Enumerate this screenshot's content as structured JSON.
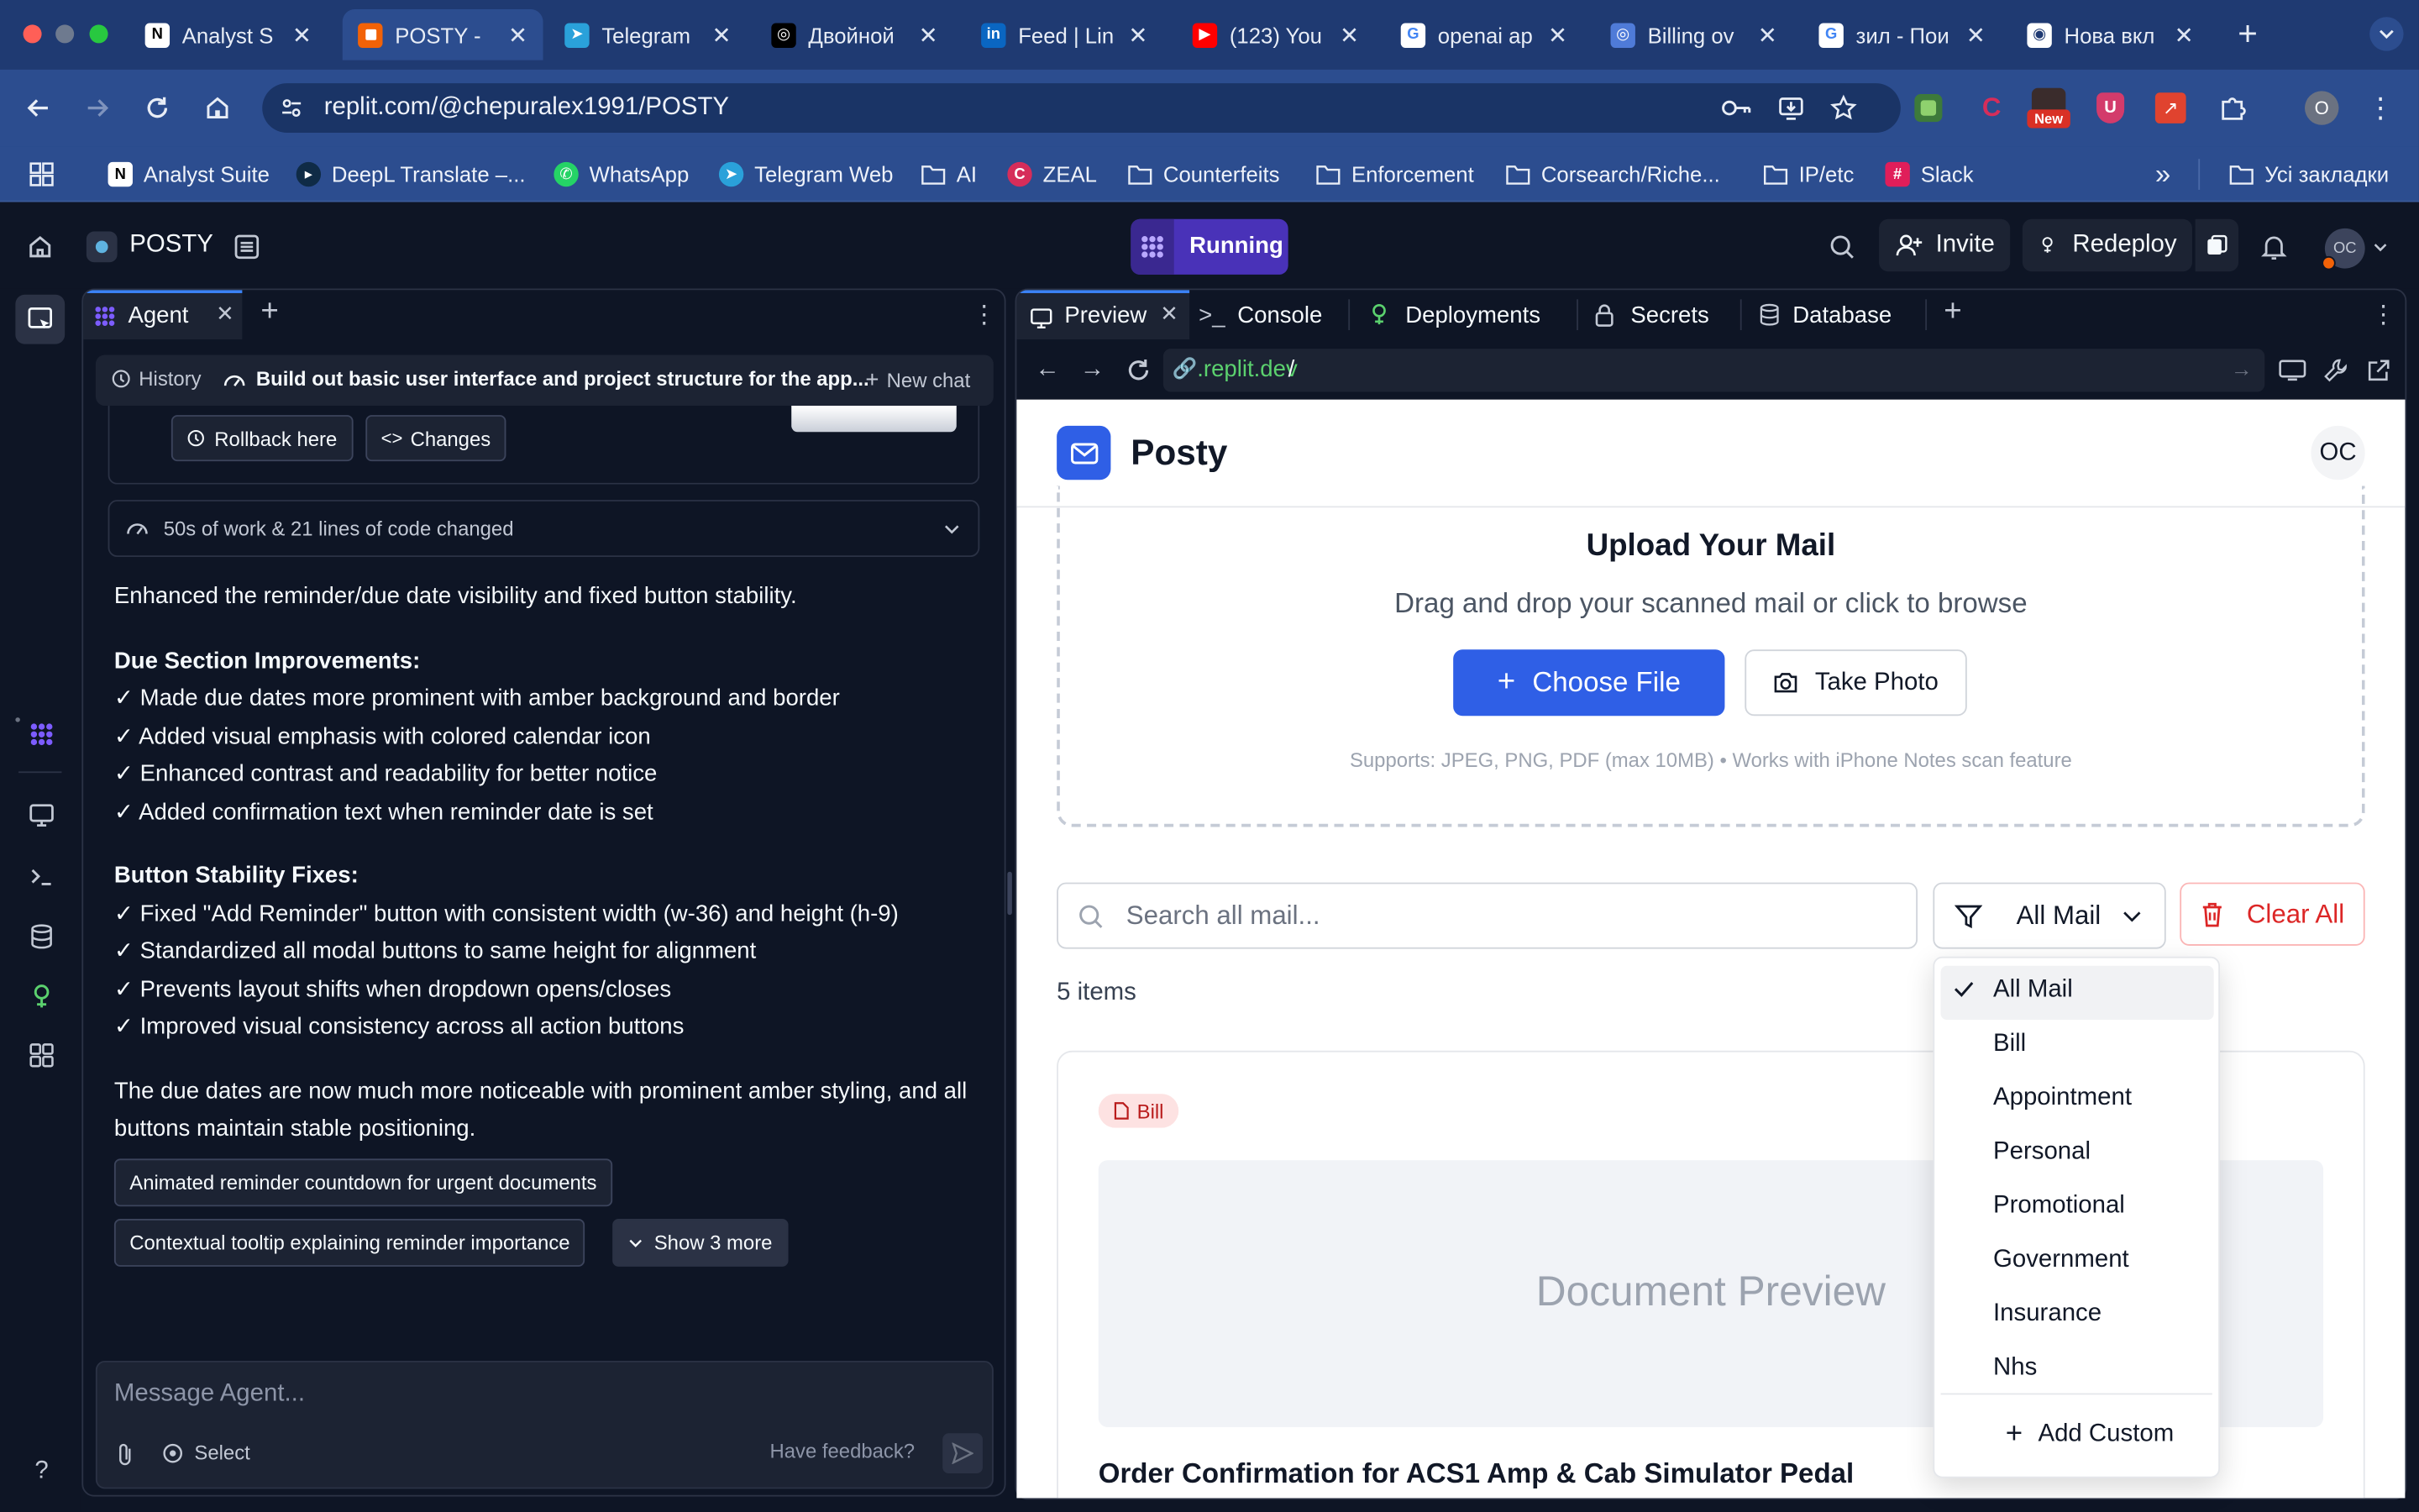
{
  "browser": {
    "tabs": [
      {
        "title": "Analyst S",
        "icon": "notion-icon",
        "fav": "N",
        "favbg": "#ffffff",
        "favfg": "#000000"
      },
      {
        "title": "POSTY - ",
        "icon": "replit-icon",
        "fav": "",
        "favbg": "#f26207",
        "favfg": "#ffffff"
      },
      {
        "title": "Telegram",
        "icon": "telegram-icon",
        "fav": "➤",
        "favbg": "#2aa1da",
        "favfg": "#ffffff"
      },
      {
        "title": "Двойной",
        "icon": "openai-icon",
        "fav": "◎",
        "favbg": "#000000",
        "favfg": "#ffffff"
      },
      {
        "title": "Feed | Lin",
        "icon": "linkedin-icon",
        "fav": "in",
        "favbg": "#0a66c2",
        "favfg": "#ffffff"
      },
      {
        "title": "(123) You",
        "icon": "youtube-icon",
        "fav": "▶",
        "favbg": "#ff0000",
        "favfg": "#ffffff"
      },
      {
        "title": "openai ap",
        "icon": "google-icon",
        "fav": "G",
        "favbg": "#ffffff",
        "favfg": "#4285f4"
      },
      {
        "title": "Billing ov",
        "icon": "openai-icon",
        "fav": "◎",
        "favbg": "#4f7bd8",
        "favfg": "#ffffff"
      },
      {
        "title": "зил - Пои",
        "icon": "google-icon",
        "fav": "G",
        "favbg": "#ffffff",
        "favfg": "#4285f4"
      },
      {
        "title": "Нова вкл",
        "icon": "chrome-icon",
        "fav": "◉",
        "favbg": "#ffffff",
        "favfg": "#1f3a72"
      }
    ],
    "url": "replit.com/@chepuralex1991/POSTY",
    "extension_badge": "New",
    "profile_initial": "O",
    "bookmarks": [
      {
        "label": "Analyst Suite",
        "icon": "notion-icon",
        "glyph": "N",
        "bg": "#ffffff",
        "fg": "#000000"
      },
      {
        "label": "DeepL Translate –...",
        "icon": "deepl-icon",
        "glyph": "▸",
        "bg": "#0f2b46",
        "fg": "#ffffff"
      },
      {
        "label": "WhatsApp",
        "icon": "whatsapp-icon",
        "glyph": "✆",
        "bg": "#25d366",
        "fg": "#ffffff"
      },
      {
        "label": "Telegram Web",
        "icon": "telegram-icon",
        "glyph": "➤",
        "bg": "#2aa1da",
        "fg": "#ffffff"
      },
      {
        "label": "AI",
        "icon": "folder-icon",
        "glyph": "",
        "bg": "",
        "fg": ""
      },
      {
        "label": "ZEAL",
        "icon": "zeal-icon",
        "glyph": "C",
        "bg": "#d62d5a",
        "fg": "#ffffff"
      },
      {
        "label": "Counterfeits",
        "icon": "folder-icon",
        "glyph": "",
        "bg": "",
        "fg": ""
      },
      {
        "label": "Enforcement",
        "icon": "folder-icon",
        "glyph": "",
        "bg": "",
        "fg": ""
      },
      {
        "label": "Corsearch/Riche...",
        "icon": "folder-icon",
        "glyph": "",
        "bg": "",
        "fg": ""
      },
      {
        "label": "IP/etc",
        "icon": "folder-icon",
        "glyph": "",
        "bg": "",
        "fg": ""
      },
      {
        "label": "Slack",
        "icon": "slack-icon",
        "glyph": "#",
        "bg": "#e01e5a",
        "fg": "#ffffff"
      }
    ],
    "all_bookmarks": "Усі закладки"
  },
  "replit": {
    "project_name": "POSTY",
    "status": "Running",
    "invite": "Invite",
    "redeploy": "Redeploy",
    "user_initials": "OC",
    "agent_tab": "Agent",
    "history": "History",
    "chat_title": "Build out basic user interface and project structure for the app...",
    "new_chat": "New chat",
    "rollback": "Rollback here",
    "changes": "Changes",
    "work_summary": "50s of work & 21 lines of code changed",
    "message": {
      "intro": "Enhanced the reminder/due date visibility and fixed button stability.",
      "h1": "Due Section Improvements:",
      "list1": [
        "✓ Made due dates more prominent with amber background and border",
        "✓ Added visual emphasis with colored calendar icon",
        "✓ Enhanced contrast and readability for better notice",
        "✓ Added confirmation text when reminder date is set"
      ],
      "h2": "Button Stability Fixes:",
      "list2": [
        "✓ Fixed \"Add Reminder\" button with consistent width (w-36) and height (h-9)",
        "✓ Standardized all modal buttons to same height for alignment",
        "✓ Prevents layout shifts when dropdown opens/closes",
        "✓ Improved visual consistency across all action buttons"
      ],
      "outro": "The due dates are now much more noticeable with prominent amber styling, and all buttons maintain stable positioning."
    },
    "suggestions": [
      "Animated reminder countdown for urgent documents",
      "Contextual tooltip explaining reminder importance"
    ],
    "show_more": "Show 3 more",
    "message_placeholder": "Message Agent...",
    "select": "Select",
    "feedback": "Have feedback?",
    "workspace_tabs": [
      "Preview",
      "Console",
      "Deployments",
      "Secrets",
      "Database"
    ],
    "preview_url_domain": ".replit.dev",
    "preview_url_path": "/"
  },
  "app": {
    "brand": "Posty",
    "avatar": "OC",
    "upload_title": "Upload Your Mail",
    "upload_subtitle": "Drag and drop your scanned mail or click to browse",
    "choose_file": "Choose File",
    "take_photo": "Take Photo",
    "supports": "Supports: JPEG, PNG, PDF (max 10MB) • Works with iPhone Notes scan feature",
    "search_placeholder": "Search all mail...",
    "filter_value": "All Mail",
    "clear_all": "Clear All",
    "items_count": "5 items",
    "filter_options": [
      "All Mail",
      "Bill",
      "Appointment",
      "Personal",
      "Promotional",
      "Government",
      "Insurance",
      "Nhs"
    ],
    "selected_option": "All Mail",
    "add_custom": "Add Custom",
    "card": {
      "tag": "Bill",
      "preview_label": "Document Preview",
      "title": "Order Confirmation for ACS1 Amp & Cab Simulator Pedal"
    }
  },
  "colors": {
    "chrome_tab_bar": "#1f3a72",
    "chrome_toolbar": "#2c4d8f",
    "replit_bg": "#0e1525",
    "running_accent": "#5c3ee8",
    "primary_blue": "#2f5fe6",
    "danger_red": "#dc2626",
    "bill_tag_bg": "#fde2e2"
  }
}
